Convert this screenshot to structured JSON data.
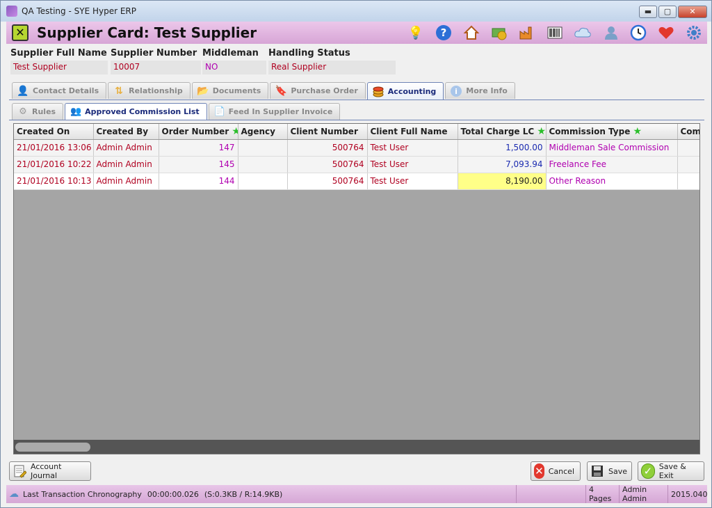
{
  "window": {
    "title": "QA Testing - SYE Hyper ERP",
    "min": "▬",
    "max": "▢",
    "close": "✕"
  },
  "header": {
    "title": "Supplier Card: Test Supplier",
    "close_glyph": "✕"
  },
  "toolbar_icons": [
    "lightbulb-icon",
    "help-icon",
    "home-icon",
    "money-icon",
    "factory-icon",
    "barcode-icon",
    "cloud-icon",
    "users-icon",
    "clock-icon",
    "heart-icon",
    "gear-icon"
  ],
  "fields": {
    "supplier_full_name": {
      "label": "Supplier Full Name",
      "value": "Test Supplier"
    },
    "supplier_number": {
      "label": "Supplier Number",
      "value": "10007"
    },
    "middleman": {
      "label": "Middleman",
      "value": "NO"
    },
    "handling_status": {
      "label": "Handling Status",
      "value": "Real Supplier"
    }
  },
  "tabs": [
    "Contact Details",
    "Relationship",
    "Documents",
    "Purchase Order",
    "Accounting",
    "More Info"
  ],
  "active_tab": "Accounting",
  "subtabs": [
    "Rules",
    "Approved Commission List",
    "Feed In Supplier Invoice"
  ],
  "active_subtab": "Approved Commission List",
  "grid": {
    "columns": [
      "Created On",
      "Created By",
      "Order Number",
      "Agency",
      "Client Number",
      "Client Full Name",
      "Total Charge LC",
      "Commission Type",
      "Com"
    ],
    "rows": [
      {
        "created_on": "21/01/2016 13:06",
        "created_by": "Admin Admin",
        "order_number": "147",
        "agency": "",
        "client_number": "500764",
        "client_full_name": "Test User",
        "total_charge": "1,500.00",
        "commission_type": "Middleman Sale Commission"
      },
      {
        "created_on": "21/01/2016 10:22",
        "created_by": "Admin Admin",
        "order_number": "145",
        "agency": "",
        "client_number": "500764",
        "client_full_name": "Test User",
        "total_charge": "7,093.94",
        "commission_type": "Freelance Fee"
      },
      {
        "created_on": "21/01/2016 10:13",
        "created_by": "Admin Admin",
        "order_number": "144",
        "agency": "",
        "client_number": "500764",
        "client_full_name": "Test User",
        "total_charge": "8,190.00",
        "commission_type": "Other Reason"
      }
    ]
  },
  "buttons": {
    "account_journal": "Account Journal",
    "cancel": "Cancel",
    "save": "Save",
    "save_exit": "Save & Exit"
  },
  "status": {
    "chronography": "Last Transaction Chronography",
    "time": "00:00:00.026",
    "size": "(S:0.3KB / R:14.9KB)",
    "pages": "4 Pages",
    "user": "Admin Admin",
    "version": "2015.040"
  },
  "colors": {
    "accent": "#d7a5d6",
    "value_red": "#b00020",
    "value_purple": "#b000b0",
    "highlight": "#ffff88"
  }
}
